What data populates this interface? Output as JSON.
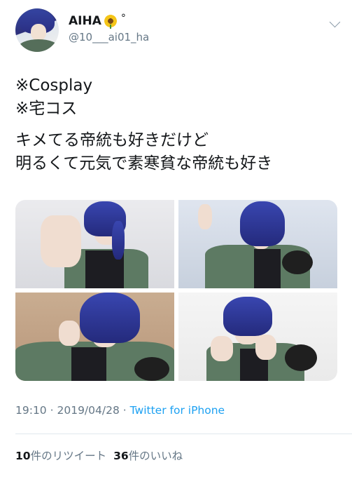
{
  "tweet": {
    "author": {
      "display_name": "AIHA",
      "name_suffix": "°",
      "name_emoji": "sunflower",
      "handle": "@10___ai01_ha"
    },
    "text_lines": [
      "※Cosplay",
      "※宅コス",
      "キメてる帝統も好きだけど",
      "明るくて元気で素寒貧な帝統も好き"
    ],
    "media_count": 4,
    "time": "19:10",
    "separator": "·",
    "date": "2019/04/28",
    "source": "Twitter for iPhone",
    "retweets": {
      "count": "10",
      "label": "件のリツイート"
    },
    "likes": {
      "count": "36",
      "label": "件のいいね"
    }
  },
  "colors": {
    "text": "#14171a",
    "secondary": "#657786",
    "link": "#1da1f2",
    "divider": "#e1e8ed"
  },
  "icons": {
    "more": "chevron-down-icon",
    "name_emoji": "sunflower-icon"
  }
}
